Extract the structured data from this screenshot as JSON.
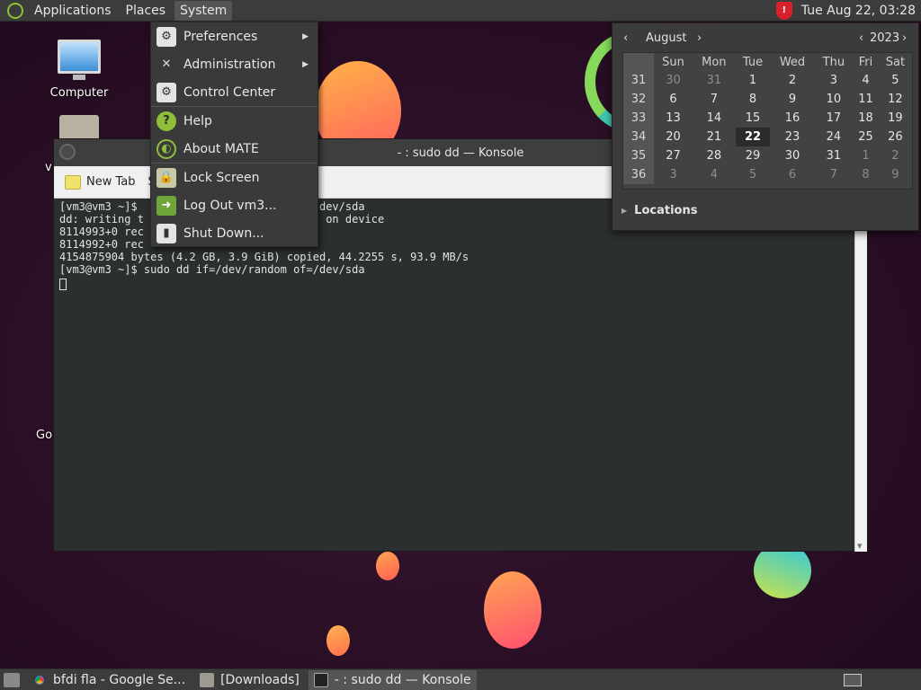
{
  "top_panel": {
    "menus": [
      "Applications",
      "Places",
      "System"
    ],
    "clock": "Tue Aug 22, 03:28",
    "tray_icon": "shield-icon"
  },
  "desktop": {
    "icons": [
      {
        "label": "Computer"
      },
      {
        "label": ""
      }
    ],
    "fragments": [
      "vi",
      "Go"
    ]
  },
  "system_menu": {
    "items": [
      {
        "label": "Preferences",
        "icon": "preferences-icon",
        "submenu": true
      },
      {
        "label": "Administration",
        "icon": "administration-icon",
        "submenu": true
      },
      {
        "label": "Control Center",
        "icon": "control-center-icon",
        "submenu": false
      },
      {
        "label": "Help",
        "icon": "help-icon",
        "submenu": false
      },
      {
        "label": "About MATE",
        "icon": "mate-icon",
        "submenu": false
      },
      {
        "label": "Lock Screen",
        "icon": "lock-icon",
        "submenu": false
      },
      {
        "label": "Log Out vm3...",
        "icon": "logout-icon",
        "submenu": false
      },
      {
        "label": "Shut Down...",
        "icon": "power-icon",
        "submenu": false
      }
    ]
  },
  "konsole": {
    "title": "- : sudo dd — Konsole",
    "toolbar": {
      "new_tab": "New Tab",
      "split_fragment": "S"
    },
    "lines": [
      "[vm3@vm3 ~]$                        of=/dev/sda",
      "dd: writing t                       left on device",
      "8114993+0 rec",
      "8114992+0 rec",
      "4154875904 bytes (4.2 GB, 3.9 GiB) copied, 44.2255 s, 93.9 MB/s",
      "[vm3@vm3 ~]$ sudo dd if=/dev/random of=/dev/sda"
    ]
  },
  "calendar": {
    "month": "August",
    "year": "2023",
    "weekdays": [
      "Sun",
      "Mon",
      "Tue",
      "Wed",
      "Thu",
      "Fri",
      "Sat"
    ],
    "weeks": [
      {
        "num": "31",
        "days": [
          {
            "d": "30",
            "dim": true
          },
          {
            "d": "31",
            "dim": true
          },
          {
            "d": "1"
          },
          {
            "d": "2"
          },
          {
            "d": "3"
          },
          {
            "d": "4"
          },
          {
            "d": "5"
          }
        ]
      },
      {
        "num": "32",
        "days": [
          {
            "d": "6"
          },
          {
            "d": "7"
          },
          {
            "d": "8"
          },
          {
            "d": "9"
          },
          {
            "d": "10"
          },
          {
            "d": "11"
          },
          {
            "d": "12"
          }
        ]
      },
      {
        "num": "33",
        "days": [
          {
            "d": "13"
          },
          {
            "d": "14"
          },
          {
            "d": "15"
          },
          {
            "d": "16"
          },
          {
            "d": "17"
          },
          {
            "d": "18"
          },
          {
            "d": "19"
          }
        ]
      },
      {
        "num": "34",
        "days": [
          {
            "d": "20"
          },
          {
            "d": "21"
          },
          {
            "d": "22",
            "today": true
          },
          {
            "d": "23"
          },
          {
            "d": "24"
          },
          {
            "d": "25"
          },
          {
            "d": "26"
          }
        ]
      },
      {
        "num": "35",
        "days": [
          {
            "d": "27"
          },
          {
            "d": "28"
          },
          {
            "d": "29"
          },
          {
            "d": "30"
          },
          {
            "d": "31"
          },
          {
            "d": "1",
            "dim": true
          },
          {
            "d": "2",
            "dim": true
          }
        ]
      },
      {
        "num": "36",
        "days": [
          {
            "d": "3",
            "dim": true
          },
          {
            "d": "4",
            "dim": true
          },
          {
            "d": "5",
            "dim": true
          },
          {
            "d": "6",
            "dim": true
          },
          {
            "d": "7",
            "dim": true
          },
          {
            "d": "8",
            "dim": true
          },
          {
            "d": "9",
            "dim": true
          }
        ]
      }
    ],
    "locations_label": "Locations"
  },
  "bottom_panel": {
    "tasks": [
      {
        "label": "bfdi fla - Google Se...",
        "icon": "chrome-icon",
        "active": false
      },
      {
        "label": "[Downloads]",
        "icon": "folder-icon",
        "active": false
      },
      {
        "label": "- : sudo dd — Konsole",
        "icon": "terminal-icon",
        "active": true
      }
    ]
  },
  "colors": {
    "accent_green": "#8fbf3a",
    "panel": "#3c3c3c",
    "terminal_bg": "#2b2f2f"
  }
}
